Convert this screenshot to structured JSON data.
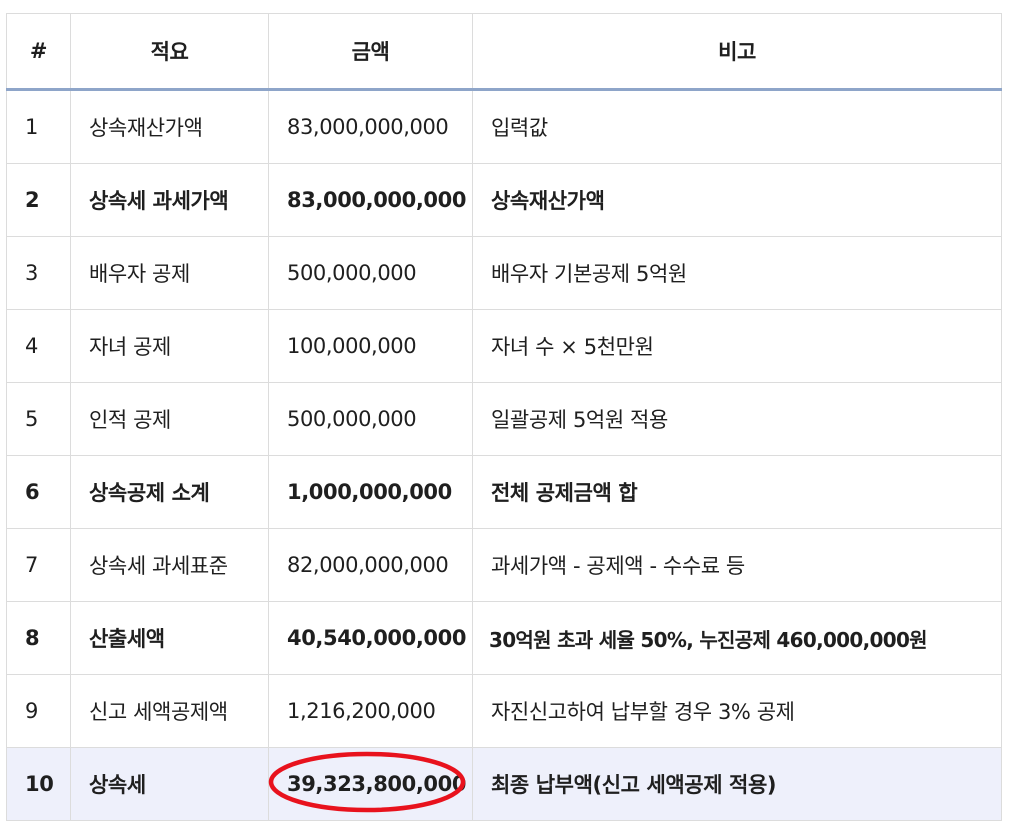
{
  "table": {
    "headers": [
      "#",
      "적요",
      "금액",
      "비고"
    ],
    "rows": [
      {
        "no": "1",
        "item": "상속재산가액",
        "amount": "83,000,000,000",
        "note": "입력값",
        "bold": false
      },
      {
        "no": "2",
        "item": "상속세 과세가액",
        "amount": "83,000,000,000",
        "note": "상속재산가액",
        "bold": true
      },
      {
        "no": "3",
        "item": "배우자 공제",
        "amount": "500,000,000",
        "note": "배우자 기본공제 5억원",
        "bold": false
      },
      {
        "no": "4",
        "item": "자녀 공제",
        "amount": "100,000,000",
        "note": "자녀 수 × 5천만원",
        "bold": false
      },
      {
        "no": "5",
        "item": "인적 공제",
        "amount": "500,000,000",
        "note": "일괄공제 5억원 적용",
        "bold": false
      },
      {
        "no": "6",
        "item": "상속공제 소계",
        "amount": "1,000,000,000",
        "note": "전체 공제금액 합",
        "bold": true
      },
      {
        "no": "7",
        "item": "상속세 과세표준",
        "amount": "82,000,000,000",
        "note": "과세가액 - 공제액 - 수수료 등",
        "bold": false
      },
      {
        "no": "8",
        "item": "산출세액",
        "amount": "40,540,000,000",
        "note": "30억원 초과 세율 50%, 누진공제 460,000,000원",
        "bold": true
      },
      {
        "no": "9",
        "item": "신고 세액공제액",
        "amount": "1,216,200,000",
        "note": "자진신고하여 납부할 경우 3% 공제",
        "bold": false
      },
      {
        "no": "10",
        "item": "상속세",
        "amount": "39,323,800,000",
        "note": "최종 납부액(신고 세액공제 적용)",
        "bold": true
      }
    ]
  },
  "colors": {
    "header_border": "#8ea5c9",
    "final_row_bg": "#eef0fb",
    "highlight_circle": "#e8121d"
  }
}
